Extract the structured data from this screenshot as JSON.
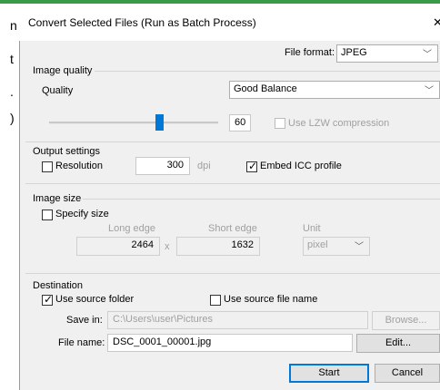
{
  "left_edge_glyphs": [
    "n",
    "t",
    ".",
    ")"
  ],
  "dialog": {
    "title": "Convert Selected Files (Run as Batch Process)",
    "close": "✕"
  },
  "file_format": {
    "label": "File format:",
    "value": "JPEG"
  },
  "image_quality": {
    "group_label": "Image quality",
    "quality_label": "Quality",
    "quality_value": "Good Balance",
    "slider_value": "60",
    "slider_percent": 60,
    "lzw_label": "Use LZW compression",
    "lzw_checked": false
  },
  "output_settings": {
    "group_label": "Output settings",
    "resolution_label": "Resolution",
    "resolution_checked": false,
    "resolution_value": "300",
    "resolution_unit": "dpi",
    "embed_icc_label": "Embed ICC profile",
    "embed_icc_checked": true
  },
  "image_size": {
    "group_label": "Image size",
    "specify_label": "Specify size",
    "specify_checked": false,
    "long_edge_label": "Long edge",
    "long_edge_value": "2464",
    "times": "x",
    "short_edge_label": "Short edge",
    "short_edge_value": "1632",
    "unit_label": "Unit",
    "unit_value": "pixel"
  },
  "destination": {
    "group_label": "Destination",
    "use_source_folder_label": "Use source folder",
    "use_source_folder_checked": true,
    "use_source_name_label": "Use source file name",
    "use_source_name_checked": false,
    "save_in_label": "Save in:",
    "save_in_value": "C:\\Users\\user\\Pictures",
    "browse_label": "Browse...",
    "file_name_label": "File name:",
    "file_name_value": "DSC_0001_00001.jpg",
    "edit_label": "Edit..."
  },
  "buttons": {
    "start": "Start",
    "cancel": "Cancel"
  },
  "colors": {
    "accent": "#0078d7",
    "topbar": "#3a9a48"
  }
}
